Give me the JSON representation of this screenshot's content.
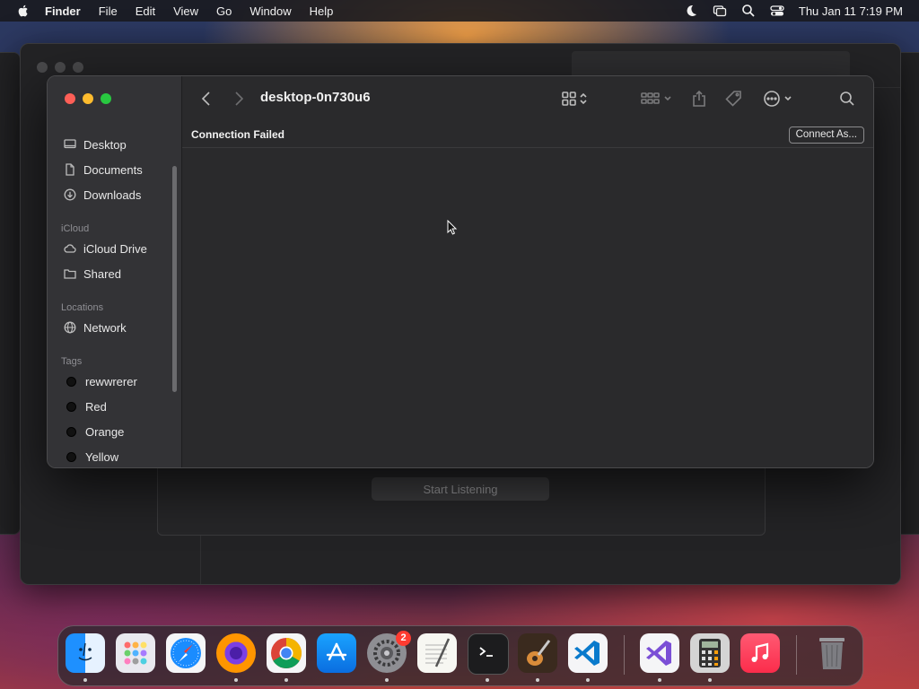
{
  "menubar": {
    "app_name": "Finder",
    "items": [
      "File",
      "Edit",
      "View",
      "Go",
      "Window",
      "Help"
    ],
    "clock": "Thu Jan 11  7:19 PM"
  },
  "finder": {
    "title": "desktop-0n730u6",
    "status_message": "Connection Failed",
    "connect_button": "Connect As...",
    "sidebar": {
      "favorites": [
        {
          "label": "Desktop",
          "icon": "desktop-icon"
        },
        {
          "label": "Documents",
          "icon": "document-icon"
        },
        {
          "label": "Downloads",
          "icon": "download-icon"
        }
      ],
      "icloud_header": "iCloud",
      "icloud": [
        {
          "label": "iCloud Drive",
          "icon": "cloud-icon"
        },
        {
          "label": "Shared",
          "icon": "shared-folder-icon"
        }
      ],
      "locations_header": "Locations",
      "locations": [
        {
          "label": "Network",
          "icon": "globe-icon"
        }
      ],
      "tags_header": "Tags",
      "tags": [
        {
          "label": "rewwrerer"
        },
        {
          "label": "Red"
        },
        {
          "label": "Orange"
        },
        {
          "label": "Yellow"
        }
      ]
    }
  },
  "background_app": {
    "button_label": "Start Listening"
  },
  "dock": {
    "apps": [
      "Finder",
      "Launchpad",
      "Safari",
      "Firefox",
      "Chrome",
      "App Store",
      "System Settings",
      "TextEdit",
      "Terminal",
      "GarageBand",
      "Visual Studio Code",
      "Visual Studio",
      "Calculator",
      "Music",
      "Trash"
    ],
    "settings_badge": "2"
  },
  "colors": {
    "close": "#fe5f57",
    "minimize": "#febc2e",
    "zoom": "#28c840",
    "window_bg": "#2a2a2c",
    "sidebar_bg": "#333336"
  }
}
